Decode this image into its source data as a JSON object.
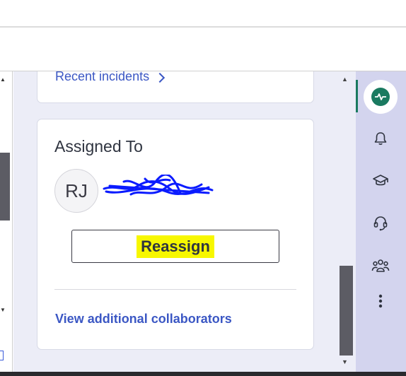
{
  "incidents": {
    "link_label": "Recent incidents"
  },
  "assigned": {
    "title": "Assigned To",
    "avatar_initials": "RJ",
    "reassign_label": "Reassign",
    "collaborators_link": "View additional collaborators"
  },
  "rail": {
    "items": [
      {
        "icon": "pulse-icon",
        "active": true
      },
      {
        "icon": "bell-icon"
      },
      {
        "icon": "graduation-cap-icon"
      },
      {
        "icon": "headset-icon"
      },
      {
        "icon": "team-icon"
      },
      {
        "icon": "more-vertical-icon"
      }
    ],
    "accent": "#1a7a60"
  },
  "colors": {
    "link": "#3b57c4",
    "highlight": "#f7f700",
    "panel_bg": "#ecedf7",
    "rail_bg": "#d3d4ee"
  }
}
